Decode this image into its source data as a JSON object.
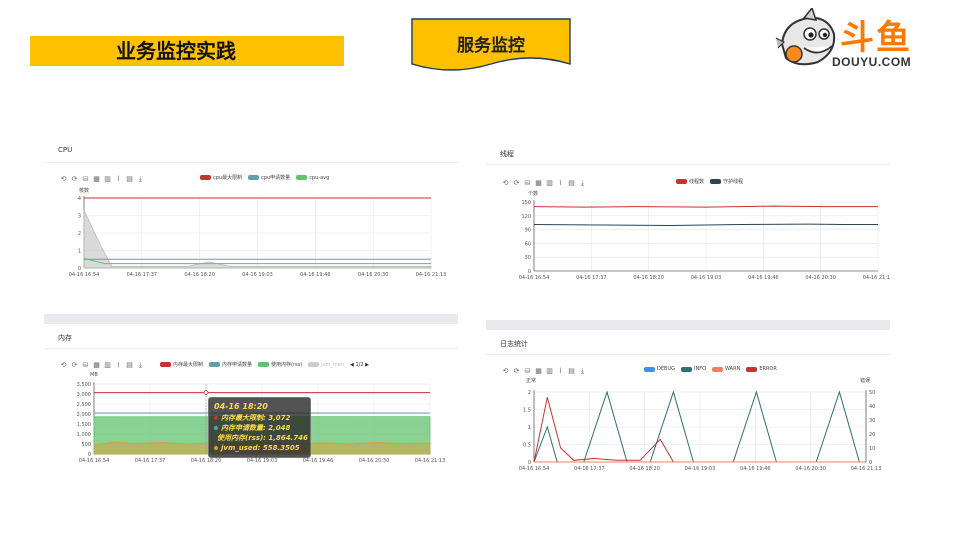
{
  "slide": {
    "title": "业务监控实践",
    "banner": "服务监控",
    "logo": {
      "brand": "斗鱼",
      "sub": "DOUYU.COM"
    }
  },
  "toolbox_icons": [
    "⟲",
    "⟳",
    "⛁",
    "▦",
    "▥",
    "⌇",
    "▤",
    "⤓"
  ],
  "colors": {
    "title_bg": "#ffc000",
    "banner_bg": "#ffc000",
    "brand": "#ff7800",
    "red": "#c23531",
    "teal": "#2f4554",
    "green": "#61c36f",
    "blue": "#61a0a8"
  },
  "panels": {
    "cpu": {
      "title": "CPU",
      "unit": "核数",
      "legend": [
        {
          "name": "cpu最大限制",
          "color": "#c23531"
        },
        {
          "name": "cpu申请数量",
          "color": "#61a0a8"
        },
        {
          "name": "cpu-avg",
          "color": "#61c36f"
        }
      ]
    },
    "threads": {
      "title": "线程",
      "unit": "个数",
      "legend": [
        {
          "name": "线程数",
          "color": "#c23531"
        },
        {
          "name": "守护线程",
          "color": "#2f4554"
        }
      ]
    },
    "memory": {
      "title": "内存",
      "unit": "MB",
      "legend": [
        {
          "name": "内存最大限制",
          "color": "#c23531"
        },
        {
          "name": "内存申请数量",
          "color": "#61a0a8"
        },
        {
          "name": "使用内存(rss)",
          "color": "#61c36f"
        },
        {
          "name": "jvm_men",
          "color": "#cccccc"
        }
      ],
      "pager": "1/2",
      "tooltip": {
        "title": "04-16 18:20",
        "rows": [
          {
            "label": "内存最大限制: 3,072",
            "color": "#c23531"
          },
          {
            "label": "内存申请数量: 2,048",
            "color": "#61a0a8"
          },
          {
            "label": "使用内存(rss): 1,864.746",
            "color": "#61c36f"
          },
          {
            "label": "jvm_used: 558.3505",
            "color": "#d4a03a"
          }
        ]
      }
    },
    "logs": {
      "title": "日志统计",
      "unit_left": "正常",
      "unit_right": "错误",
      "legend": [
        {
          "name": "DEBUG",
          "color": "#3f8ff0"
        },
        {
          "name": "INFO",
          "color": "#2f6f6f"
        },
        {
          "name": "WARN",
          "color": "#f08060"
        },
        {
          "name": "ERROR",
          "color": "#c23531"
        }
      ]
    }
  },
  "chart_data": [
    {
      "id": "cpu",
      "type": "area",
      "x": [
        "04-16 16:54",
        "04-16 17:37",
        "04-16 18:20",
        "04-16 19:03",
        "04-16 19:46",
        "04-16 20:30",
        "04-16 21:13"
      ],
      "yticks": [
        0,
        1,
        2,
        3,
        4
      ],
      "ylim": [
        0,
        4
      ],
      "series": [
        {
          "name": "cpu最大限制",
          "color": "#c23531",
          "points": [
            [
              0,
              4
            ],
            [
              1,
              4
            ]
          ]
        },
        {
          "name": "cpu申请数量",
          "color": "#61a0a8",
          "points": [
            [
              0,
              0.5
            ],
            [
              1,
              0.5
            ]
          ]
        },
        {
          "name": "cpu-avg",
          "color": "#61c36f",
          "points": [
            [
              0,
              0.55
            ],
            [
              0.06,
              0.25
            ],
            [
              1,
              0.25
            ]
          ]
        },
        {
          "name": "gray",
          "color": "#bbbbbb",
          "area": true,
          "points": [
            [
              0,
              3.3
            ],
            [
              0.05,
              1.2
            ],
            [
              0.08,
              0.1
            ],
            [
              0.3,
              0.1
            ],
            [
              0.36,
              0.35
            ],
            [
              0.42,
              0.1
            ],
            [
              1,
              0.1
            ]
          ]
        }
      ]
    },
    {
      "id": "threads",
      "type": "line",
      "x": [
        "04-16 16:54",
        "04-16 17:37",
        "04-16 18:20",
        "04-16 19:03",
        "04-16 19:46",
        "04-16 20:30",
        "04-16 21:13"
      ],
      "yticks": [
        0,
        30,
        60,
        90,
        120,
        150
      ],
      "ylim": [
        0,
        150
      ],
      "series": [
        {
          "name": "线程数",
          "color": "#c23531",
          "points": [
            [
              0,
              140
            ],
            [
              0.15,
              139
            ],
            [
              0.3,
              140
            ],
            [
              0.5,
              139
            ],
            [
              0.7,
              141
            ],
            [
              0.85,
              140
            ],
            [
              1,
              140
            ]
          ]
        },
        {
          "name": "守护线程",
          "color": "#2f4554",
          "points": [
            [
              0,
              101
            ],
            [
              0.2,
              100
            ],
            [
              0.4,
              99
            ],
            [
              0.6,
              101
            ],
            [
              0.8,
              102
            ],
            [
              0.9,
              101
            ],
            [
              1,
              101
            ]
          ]
        }
      ]
    },
    {
      "id": "memory",
      "type": "area",
      "x": [
        "04-16 16:54",
        "04-16 17:37",
        "04-16 18:20",
        "04-16 19:03",
        "04-16 19:46",
        "04-16 20:30",
        "04-16 21:13"
      ],
      "yticks": [
        0,
        500,
        1000,
        1500,
        2000,
        2500,
        3000,
        3500
      ],
      "ylim": [
        0,
        3500
      ],
      "series": [
        {
          "name": "内存最大限制",
          "color": "#c23531",
          "points": [
            [
              0,
              3072
            ],
            [
              1,
              3072
            ]
          ]
        },
        {
          "name": "内存申请数量",
          "color": "#61a0a8",
          "points": [
            [
              0,
              2048
            ],
            [
              1,
              2048
            ]
          ]
        },
        {
          "name": "使用内存(rss)",
          "color": "#61c36f",
          "area": true,
          "points": [
            [
              0,
              1860
            ],
            [
              0.5,
              1865
            ],
            [
              1,
              1870
            ]
          ]
        },
        {
          "name": "jvm_used",
          "color": "#d4a03a",
          "area": true,
          "points": [
            [
              0,
              450
            ],
            [
              0.06,
              600
            ],
            [
              0.12,
              520
            ],
            [
              0.2,
              580
            ],
            [
              0.28,
              500
            ],
            [
              0.36,
              560
            ],
            [
              0.44,
              520
            ],
            [
              0.52,
              600
            ],
            [
              0.6,
              480
            ],
            [
              0.68,
              560
            ],
            [
              0.76,
              500
            ],
            [
              0.84,
              580
            ],
            [
              0.92,
              520
            ],
            [
              1,
              550
            ]
          ]
        }
      ]
    },
    {
      "id": "logs",
      "type": "line",
      "x": [
        "04-16 16:54",
        "04-16 17:37",
        "04-16 18:20",
        "04-16 19:03",
        "04-16 19:46",
        "04-16 20:30",
        "04-16 21:13"
      ],
      "yticks": [
        0,
        0.5,
        1,
        1.5,
        2
      ],
      "ylim": [
        0,
        2
      ],
      "y2ticks": [
        0,
        10,
        20,
        30,
        40,
        50
      ],
      "y2lim": [
        0,
        50
      ],
      "series": [
        {
          "name": "INFO",
          "color": "#2f6f6f",
          "points": [
            [
              0,
              0
            ],
            [
              0.04,
              1
            ],
            [
              0.07,
              0
            ],
            [
              0.15,
              0
            ],
            [
              0.22,
              2
            ],
            [
              0.28,
              0
            ],
            [
              0.35,
              0
            ],
            [
              0.42,
              2
            ],
            [
              0.48,
              0
            ],
            [
              0.6,
              0
            ],
            [
              0.67,
              2
            ],
            [
              0.73,
              0
            ],
            [
              0.85,
              0
            ],
            [
              0.92,
              2
            ],
            [
              0.98,
              0
            ],
            [
              1,
              0
            ]
          ]
        },
        {
          "name": "ERROR",
          "color": "#c23531",
          "points": [
            [
              0,
              0
            ],
            [
              0.04,
              1.85
            ],
            [
              0.08,
              0.4
            ],
            [
              0.12,
              0.05
            ],
            [
              0.18,
              0.1
            ],
            [
              0.25,
              0.05
            ],
            [
              0.32,
              0.05
            ],
            [
              0.38,
              0.65
            ],
            [
              0.42,
              0
            ],
            [
              1,
              0
            ]
          ]
        },
        {
          "name": "WARN",
          "color": "#f08060",
          "points": [
            [
              0,
              0
            ],
            [
              1,
              0
            ]
          ]
        }
      ]
    }
  ]
}
